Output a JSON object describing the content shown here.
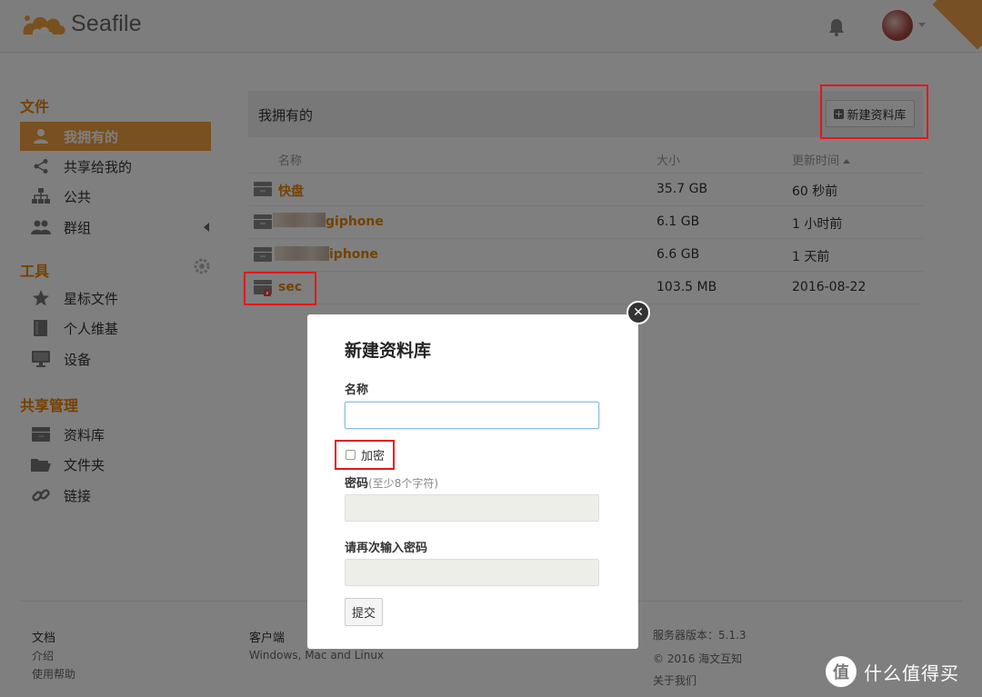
{
  "header": {
    "logo_text": "Seafile"
  },
  "sidebar": {
    "section_files": "文件",
    "files_items": [
      {
        "label": "我拥有的",
        "icon": "user-icon",
        "active": true
      },
      {
        "label": "共享给我的",
        "icon": "share-icon"
      },
      {
        "label": "公共",
        "icon": "org-icon"
      },
      {
        "label": "群组",
        "icon": "group-icon"
      }
    ],
    "section_tools": "工具",
    "tools_items": [
      {
        "label": "星标文件",
        "icon": "star-icon"
      },
      {
        "label": "个人维基",
        "icon": "book-icon"
      },
      {
        "label": "设备",
        "icon": "monitor-icon"
      }
    ],
    "section_share_admin": "共享管理",
    "share_items": [
      {
        "label": "资料库",
        "icon": "library-icon"
      },
      {
        "label": "文件夹",
        "icon": "folder-icon"
      },
      {
        "label": "链接",
        "icon": "link-icon"
      }
    ]
  },
  "main": {
    "title": "我拥有的",
    "new_library_label": "新建资料库",
    "columns": {
      "name": "名称",
      "size": "大小",
      "updated": "更新时间"
    },
    "rows": [
      {
        "name": "快盘",
        "size": "35.7 GB",
        "updated": "60 秒前"
      },
      {
        "name": "giphone",
        "size": "6.1 GB",
        "updated": "1 小时前"
      },
      {
        "name": "iphone",
        "size": "6.6 GB",
        "updated": "1 天前"
      },
      {
        "name": "sec",
        "size": "103.5 MB",
        "updated": "2016-08-22"
      }
    ]
  },
  "footer": {
    "doc_head": "文档",
    "doc_links": [
      "介绍",
      "使用帮助"
    ],
    "client_head": "客户端",
    "client_sub": "Windows, Mac and Linux",
    "server_version": "服务器版本：5.1.3",
    "copyright": "© 2016 海文互知",
    "about": "关于我们"
  },
  "modal": {
    "title": "新建资料库",
    "name_label": "名称",
    "name_value": "",
    "encrypt_label": "加密",
    "password_label": "密码",
    "password_hint": "(至少8个字符)",
    "repeat_label": "请再次输入密码",
    "submit_label": "提交"
  },
  "watermark": {
    "glyph": "值",
    "text": "什么值得买"
  },
  "colors": {
    "accent": "#eb8205",
    "active_bg": "#f3a13e",
    "annotation": "#e8141a"
  }
}
